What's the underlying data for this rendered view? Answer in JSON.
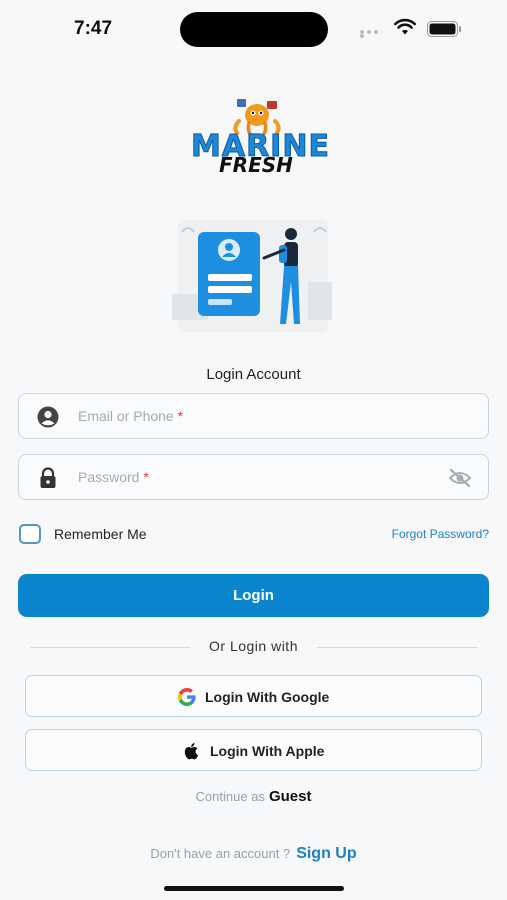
{
  "status_bar": {
    "time": "7:47"
  },
  "brand": {
    "name_line1": "MARINE",
    "name_line2": "FRESH"
  },
  "title": "Login Account",
  "email": {
    "placeholder": "Email or Phone",
    "required_mark": "*",
    "value": ""
  },
  "password": {
    "placeholder": "Password",
    "required_mark": "*",
    "value": ""
  },
  "remember": {
    "label": "Remember Me",
    "checked": false
  },
  "forgot_link": "Forgot Password?",
  "login_button": "Login",
  "divider_text": "Or Login with",
  "social": {
    "google": "Login With Google",
    "apple": "Login With Apple"
  },
  "guest": {
    "prefix": "Continue as",
    "label": "Guest"
  },
  "signup": {
    "prefix": "Don't have an account ?",
    "link": "Sign Up"
  },
  "colors": {
    "accent": "#0c85cf",
    "link": "#1f7fc4",
    "required": "#e53935"
  },
  "icons": [
    "wifi-icon",
    "battery-icon",
    "user-icon",
    "lock-icon",
    "eye-off-icon",
    "google-icon",
    "apple-icon"
  ]
}
